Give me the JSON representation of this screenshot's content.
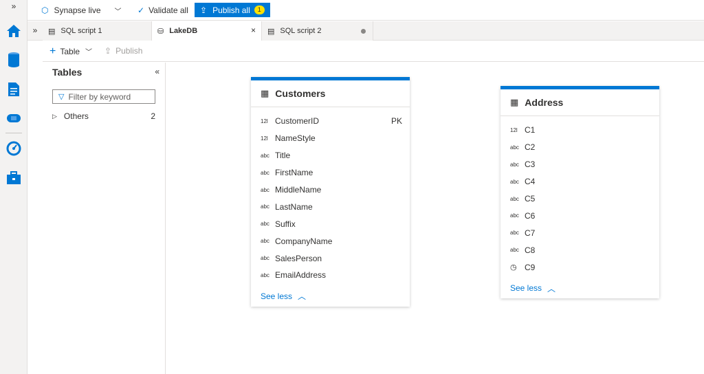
{
  "colors": {
    "accent": "#0078d4",
    "badge": "#fce100"
  },
  "rail": {
    "icons": [
      "home-icon",
      "data-icon",
      "develop-icon",
      "integrate-icon",
      "monitor-icon",
      "manage-icon"
    ]
  },
  "topbar": {
    "workspace_label": "Synapse live",
    "validate_label": "Validate all",
    "publish_label": "Publish all",
    "publish_badge": "1"
  },
  "tabs": [
    {
      "label": "SQL script 1"
    },
    {
      "label": "LakeDB",
      "close": "×"
    },
    {
      "label": "SQL script 2"
    }
  ],
  "toolbar": {
    "table_label": "Table",
    "publish_label": "Publish"
  },
  "panel": {
    "title": "Tables",
    "filter_placeholder": "Filter by keyword",
    "groups": [
      {
        "label": "Others",
        "count": "2"
      }
    ]
  },
  "customers": {
    "title": "Customers",
    "columns": [
      {
        "type": "12l",
        "name": "CustomerID",
        "key": "PK"
      },
      {
        "type": "12l",
        "name": "NameStyle"
      },
      {
        "type": "abc",
        "name": "Title"
      },
      {
        "type": "abc",
        "name": "FirstName"
      },
      {
        "type": "abc",
        "name": "MiddleName"
      },
      {
        "type": "abc",
        "name": "LastName"
      },
      {
        "type": "abc",
        "name": "Suffix"
      },
      {
        "type": "abc",
        "name": "CompanyName"
      },
      {
        "type": "abc",
        "name": "SalesPerson"
      },
      {
        "type": "abc",
        "name": "EmailAddress"
      }
    ],
    "see_less": "See less"
  },
  "address": {
    "title": "Address",
    "columns": [
      {
        "type": "12l",
        "name": "C1"
      },
      {
        "type": "abc",
        "name": "C2"
      },
      {
        "type": "abc",
        "name": "C3"
      },
      {
        "type": "abc",
        "name": "C4"
      },
      {
        "type": "abc",
        "name": "C5"
      },
      {
        "type": "abc",
        "name": "C6"
      },
      {
        "type": "abc",
        "name": "C7"
      },
      {
        "type": "abc",
        "name": "C8"
      },
      {
        "type": "datetime-icon",
        "name": "C9"
      }
    ],
    "see_less": "See less"
  }
}
